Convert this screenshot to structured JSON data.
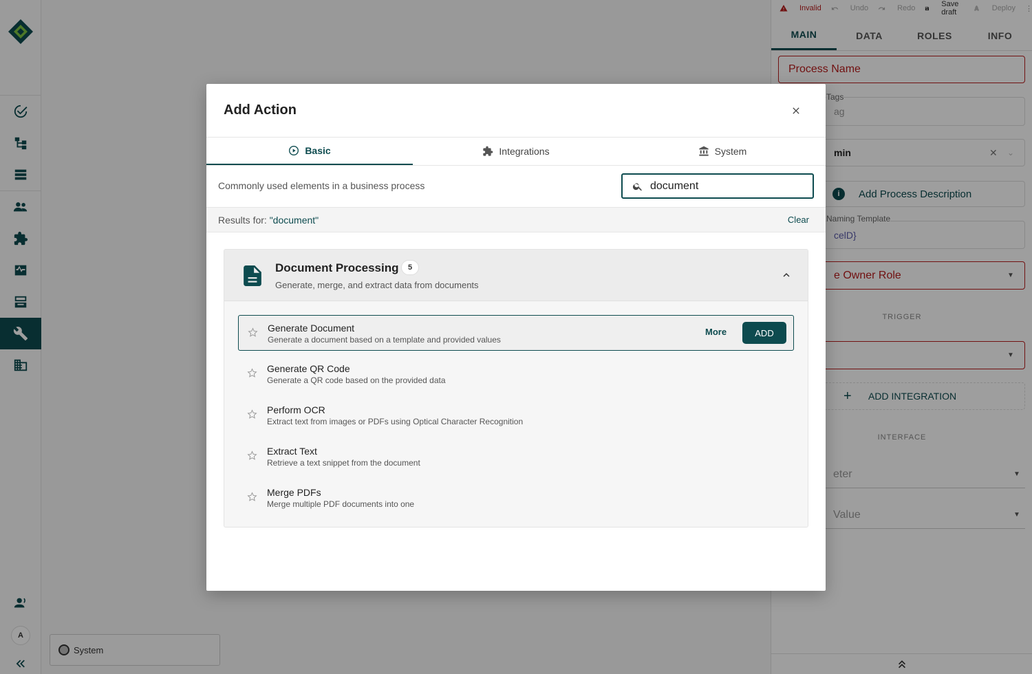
{
  "sidebar": {
    "nav": [
      "tasks-icon",
      "process-tree-icon",
      "list-icon",
      "users-icon",
      "integrations-icon",
      "monitor-icon",
      "inbox-icon",
      "tools-icon",
      "building-icon"
    ],
    "avatar_initial": "A"
  },
  "canvas": {
    "system_label": "System"
  },
  "right_panel": {
    "toolbar": {
      "invalid": "Invalid",
      "undo": "Undo",
      "redo": "Redo",
      "save_draft": "Save draft",
      "deploy": "Deploy"
    },
    "tabs": [
      "MAIN",
      "DATA",
      "ROLES",
      "INFO"
    ],
    "process_name_placeholder": "Process Name",
    "tags_label": "Tags",
    "tags_placeholder": "ag",
    "role_value": "min",
    "add_description": "Add Process Description",
    "naming_template_label": "Naming Template",
    "naming_template_value": "celD}",
    "owner_role": "e Owner Role",
    "trigger_label": "TRIGGER",
    "add_integration": "ADD INTEGRATION",
    "interface_label": "INTERFACE",
    "parameter_placeholder": "eter",
    "value_placeholder": "Value"
  },
  "modal": {
    "title": "Add Action",
    "tabs": [
      {
        "label": "Basic",
        "icon": "play-circle-icon"
      },
      {
        "label": "Integrations",
        "icon": "puzzle-icon"
      },
      {
        "label": "System",
        "icon": "bank-icon"
      }
    ],
    "subtitle": "Commonly used elements in a business process",
    "search_value": "document",
    "results_prefix": "Results for: ",
    "results_query": "\"document\"",
    "clear_label": "Clear",
    "group": {
      "title": "Document Processing",
      "count": "5",
      "description": "Generate, merge, and extract data from documents",
      "items": [
        {
          "title": "Generate Document",
          "description": "Generate a document based on a template and provided values"
        },
        {
          "title": "Generate QR Code",
          "description": "Generate a QR code based on the provided data"
        },
        {
          "title": "Perform OCR",
          "description": "Extract text from images or PDFs using Optical Character Recognition"
        },
        {
          "title": "Extract Text",
          "description": "Retrieve a text snippet from the document"
        },
        {
          "title": "Merge PDFs",
          "description": "Merge multiple PDF documents into one"
        }
      ],
      "more_label": "More",
      "add_label": "ADD"
    }
  },
  "colors": {
    "primary": "#0d4b4f",
    "error": "#b71c1c"
  }
}
